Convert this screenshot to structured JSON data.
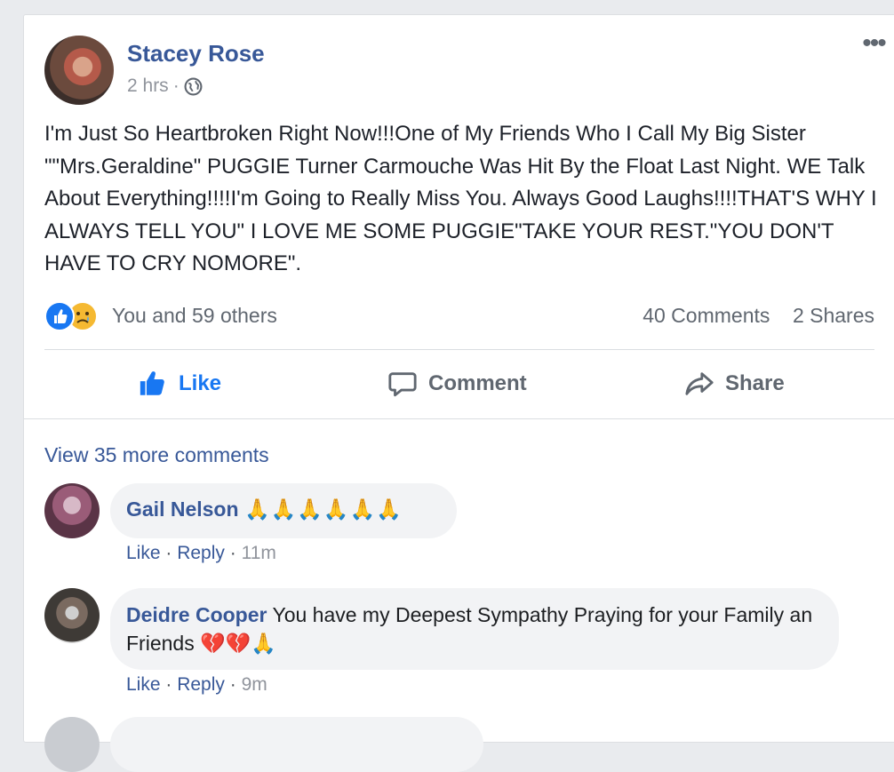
{
  "post": {
    "author": "Stacey Rose",
    "time": "2 hrs",
    "visibility_icon": "globe-icon",
    "more_icon": "•••",
    "text": "I'm Just So Heartbroken Right Now!!!One of My Friends Who I Call My Big Sister \"\"Mrs.Geraldine\" PUGGIE Turner Carmouche Was Hit By the Float Last Night. WE Talk About Everything!!!!I'm Going to Really Miss You. Always Good Laughs!!!!THAT'S WHY I ALWAYS TELL YOU\" I LOVE ME SOME PUGGIE\"TAKE YOUR REST.\"YOU DON'T HAVE TO CRY NOMORE\"."
  },
  "reactions": {
    "types": [
      "like",
      "sad"
    ],
    "summary": "You and 59 others",
    "comments": "40 Comments",
    "shares": "2 Shares"
  },
  "actions": {
    "like": "Like",
    "comment": "Comment",
    "share": "Share"
  },
  "comments_section": {
    "view_more": "View 35 more comments",
    "comments": [
      {
        "author": "Gail Nelson",
        "text": "🙏🙏🙏🙏🙏🙏",
        "like": "Like",
        "reply": "Reply",
        "time": "11m"
      },
      {
        "author": "Deidre Cooper",
        "text": "You have my Deepest Sympathy Praying for your Family an Friends",
        "emojis": "💔💔🙏",
        "like": "Like",
        "reply": "Reply",
        "time": "9m"
      }
    ]
  },
  "colors": {
    "link_blue": "#385898",
    "like_blue": "#1877f2",
    "text": "#1d2129",
    "muted": "#606770",
    "bubble": "#f2f3f5",
    "page_bg": "#e9ebee"
  }
}
